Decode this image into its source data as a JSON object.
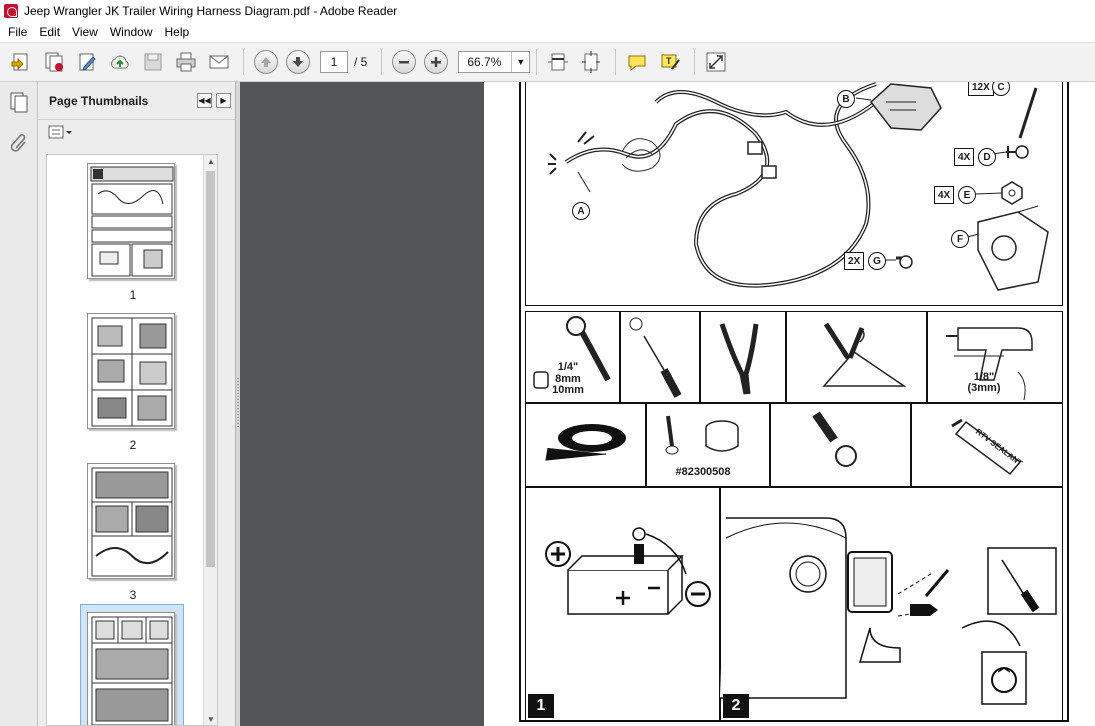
{
  "window": {
    "title": "Jeep Wrangler JK Trailer Wiring Harness Diagram.pdf - Adobe Reader"
  },
  "menu": [
    "File",
    "Edit",
    "View",
    "Window",
    "Help"
  ],
  "toolbar": {
    "page_current": "1",
    "page_total": "/ 5",
    "zoom": "66.7%"
  },
  "thumbnails": {
    "title": "Page Thumbnails",
    "pages": [
      "1",
      "2",
      "3"
    ]
  },
  "diagram": {
    "parts": {
      "a": "A",
      "b": "B",
      "c": "C",
      "d": "D",
      "e": "E",
      "f": "F",
      "g": "G",
      "qty_c": "12X",
      "qty_d": "4X",
      "qty_e": "4X",
      "qty_g": "2X"
    },
    "tools": {
      "socket_drive": "1/4\"",
      "socket_8": "8mm",
      "socket_10": "10mm",
      "drill_bit": "1/8\"",
      "drill_bit_mm": "(3mm)",
      "grommet_part": "#82300508",
      "tube_label": "RTV SEALANT"
    },
    "steps": [
      "1",
      "2"
    ]
  },
  "colors": {
    "accent": "#c8102e",
    "doc_bg": "#525659",
    "panel_bg": "#ededed"
  }
}
